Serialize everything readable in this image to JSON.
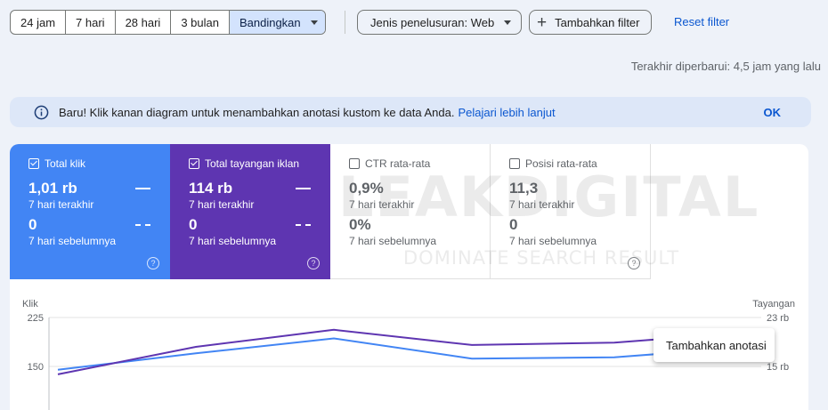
{
  "date_range": {
    "options": [
      "24 jam",
      "7 hari",
      "28 hari",
      "3 bulan"
    ],
    "compare_label": "Bandingkan"
  },
  "filters": {
    "search_type_label": "Jenis penelusuran: Web",
    "add_filter_label": "Tambahkan filter",
    "reset_label": "Reset filter"
  },
  "last_updated": "Terakhir diperbarui: 4,5 jam yang lalu",
  "banner": {
    "message": "Baru! Klik kanan diagram untuk menambahkan anotasi kustom ke data Anda.",
    "link": "Pelajari lebih lanjut",
    "ok": "OK"
  },
  "metrics": [
    {
      "label": "Total klik",
      "value": "1,01 rb",
      "period": "7 hari terakhir",
      "prev_value": "0",
      "prev_period": "7 hari sebelumnya",
      "checked": true
    },
    {
      "label": "Total tayangan iklan",
      "value": "114 rb",
      "period": "7 hari terakhir",
      "prev_value": "0",
      "prev_period": "7 hari sebelumnya",
      "checked": true
    },
    {
      "label": "CTR rata-rata",
      "value": "0,9%",
      "period": "7 hari terakhir",
      "prev_value": "0%",
      "prev_period": "7 hari sebelumnya",
      "checked": false
    },
    {
      "label": "Posisi rata-rata",
      "value": "11,3",
      "period": "7 hari terakhir",
      "prev_value": "0",
      "prev_period": "7 hari sebelumnya",
      "checked": false
    }
  ],
  "help_glyph": "?",
  "watermark": {
    "title": "LEAKDIGITAL",
    "tagline": "DOMINATE SEARCH RESULT"
  },
  "chart_data": {
    "type": "line",
    "left_axis_label": "Klik",
    "right_axis_label": "Tayangan",
    "left_ticks": [
      "225",
      "150"
    ],
    "right_ticks": [
      "23 rb",
      "15 rb"
    ],
    "series": [
      {
        "name": "Klik",
        "color": "#4285f4",
        "values": [
          145,
          170,
          193,
          162,
          164,
          180
        ]
      },
      {
        "name": "Tayangan",
        "color": "#5e35b1",
        "values": [
          13700,
          18200,
          21000,
          18500,
          18900,
          20600
        ]
      }
    ]
  },
  "context_menu": {
    "item": "Tambahkan anotasi"
  },
  "colors": {
    "clicks": "#4285f4",
    "impressions": "#5e35b1",
    "accent": "#0b57d0"
  }
}
